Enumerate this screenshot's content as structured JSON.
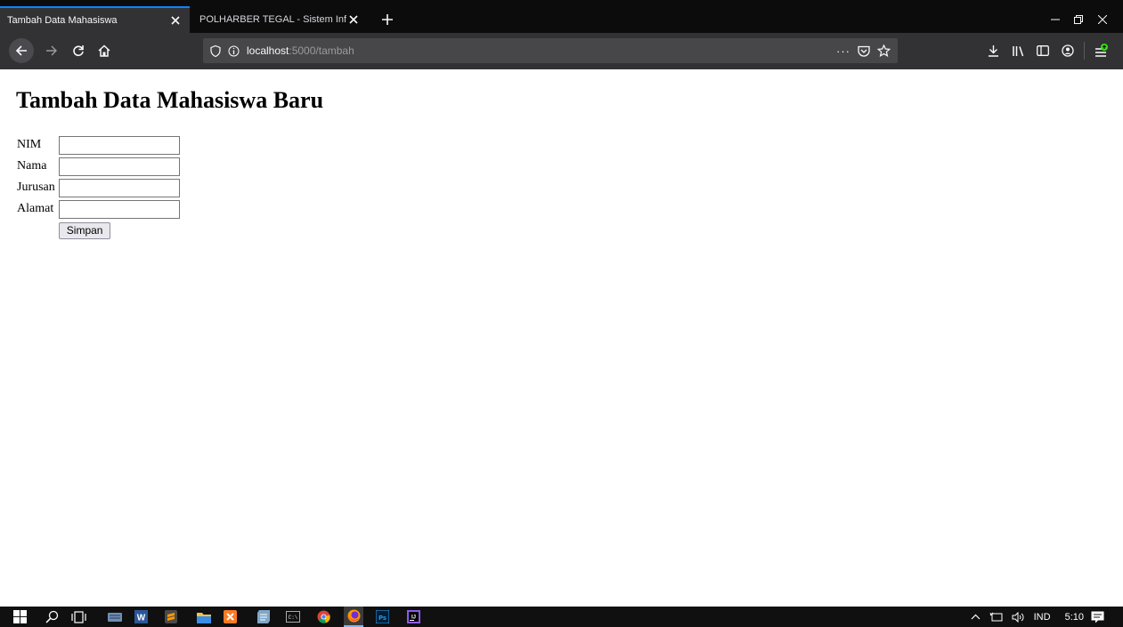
{
  "browser": {
    "tabs": [
      {
        "title": "Tambah Data Mahasiswa",
        "active": true
      },
      {
        "title": "POLHARBER TEGAL - Sistem Inform",
        "active": false
      }
    ],
    "url": {
      "host": "localhost",
      "path": ":5000/tambah"
    }
  },
  "page": {
    "heading": "Tambah Data Mahasiswa Baru",
    "form": {
      "fields": [
        {
          "label": "NIM",
          "value": ""
        },
        {
          "label": "Nama",
          "value": ""
        },
        {
          "label": "Jurusan",
          "value": ""
        },
        {
          "label": "Alamat",
          "value": ""
        }
      ],
      "submit_label": "Simpan"
    }
  },
  "taskbar": {
    "apps": [
      "start-icon",
      "search-icon",
      "task-view-icon",
      "keyboard-icon",
      "word-icon",
      "sublime-icon",
      "file-explorer-icon",
      "xampp-icon",
      "notes-icon",
      "terminal-icon",
      "chrome-icon",
      "firefox-icon",
      "photoshop-icon",
      "intellij-icon"
    ],
    "tray": {
      "language": "IND",
      "time": "5:10"
    }
  },
  "colors": {
    "chrome_dark": "#0c0c0d",
    "toolbar": "#323234",
    "accent": "#0a84ff"
  }
}
